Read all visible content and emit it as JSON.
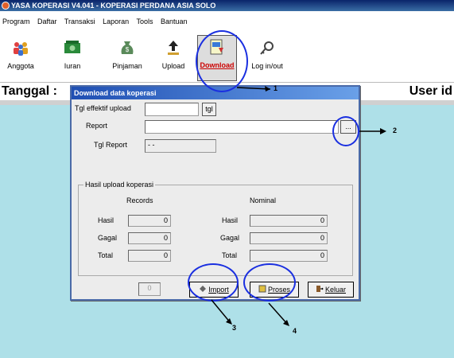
{
  "window": {
    "title": "YASA KOPERASI V4.041 - KOPERASI PERDANA ASIA SOLO"
  },
  "menu": [
    "Program",
    "Daftar",
    "Transaksi",
    "Laporan",
    "Tools",
    "Bantuan"
  ],
  "toolbar": {
    "anggota": "Anggota",
    "iuran": "Iuran",
    "pinjaman": "Pinjaman",
    "upload": "Upload",
    "download": "Download",
    "login": "Log in/out"
  },
  "workspace": {
    "tanggal_label": "Tanggal :",
    "userid_label": "User id"
  },
  "dialog": {
    "title": "Download data koperasi",
    "tgl_effektif_label": "Tgl effektif upload",
    "tgl_effektif_value": "",
    "tgl_button": "tgl",
    "report_label": "Report",
    "report_value": "",
    "browse_button": "...",
    "tgl_report_label": "Tgl Report",
    "tgl_report_value": "- -",
    "group_caption": "Hasil upload koperasi",
    "records_header": "Records",
    "nominal_header": "Nominal",
    "rows": [
      {
        "label": "Hasil",
        "records": "0",
        "nominal": "0"
      },
      {
        "label": "Gagal",
        "records": "0",
        "nominal": "0"
      },
      {
        "label": "Total",
        "records": "0",
        "nominal": "0"
      }
    ],
    "counter_value": "0",
    "import_label": "Import",
    "proses_label": "Proses",
    "keluar_label": "Keluar"
  },
  "annotations": [
    "1",
    "2",
    "3",
    "4"
  ],
  "colors": {
    "annotation": "#1a2fe0",
    "workspace": "#aee0e8",
    "dialog_title": "#1f4fb3"
  }
}
